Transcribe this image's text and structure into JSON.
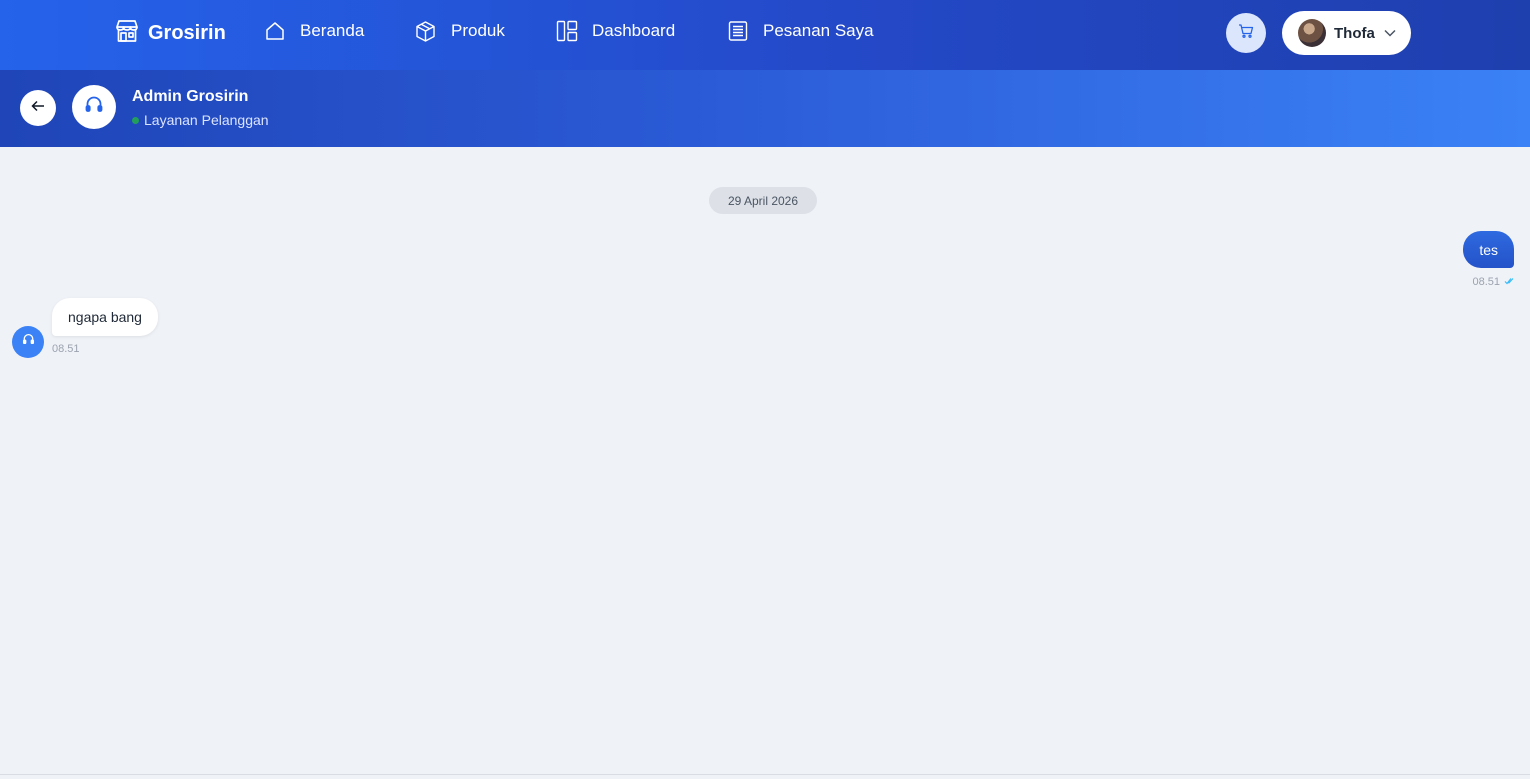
{
  "navbar": {
    "brand": "Grosirin",
    "items": [
      {
        "label": "Beranda",
        "icon": "home-icon"
      },
      {
        "label": "Produk",
        "icon": "box-icon"
      },
      {
        "label": "Dashboard",
        "icon": "dashboard-icon"
      },
      {
        "label": "Pesanan Saya",
        "icon": "receipt-icon"
      }
    ],
    "cart_icon": "cart-icon",
    "user": {
      "name": "Thofa",
      "menu_icon": "chevron-down-icon"
    }
  },
  "chat": {
    "agent_name": "Admin Grosirin",
    "agent_status": "Layanan Pelanggan",
    "date": "29 April 2026",
    "messages": [
      {
        "direction": "out",
        "text": "tes",
        "time": "08.51"
      },
      {
        "direction": "in",
        "text": "ngapa bang",
        "time": "08.51"
      }
    ]
  },
  "colors": {
    "primary": "#2563eb",
    "background": "#eff2f7",
    "online": "#22a05b"
  }
}
